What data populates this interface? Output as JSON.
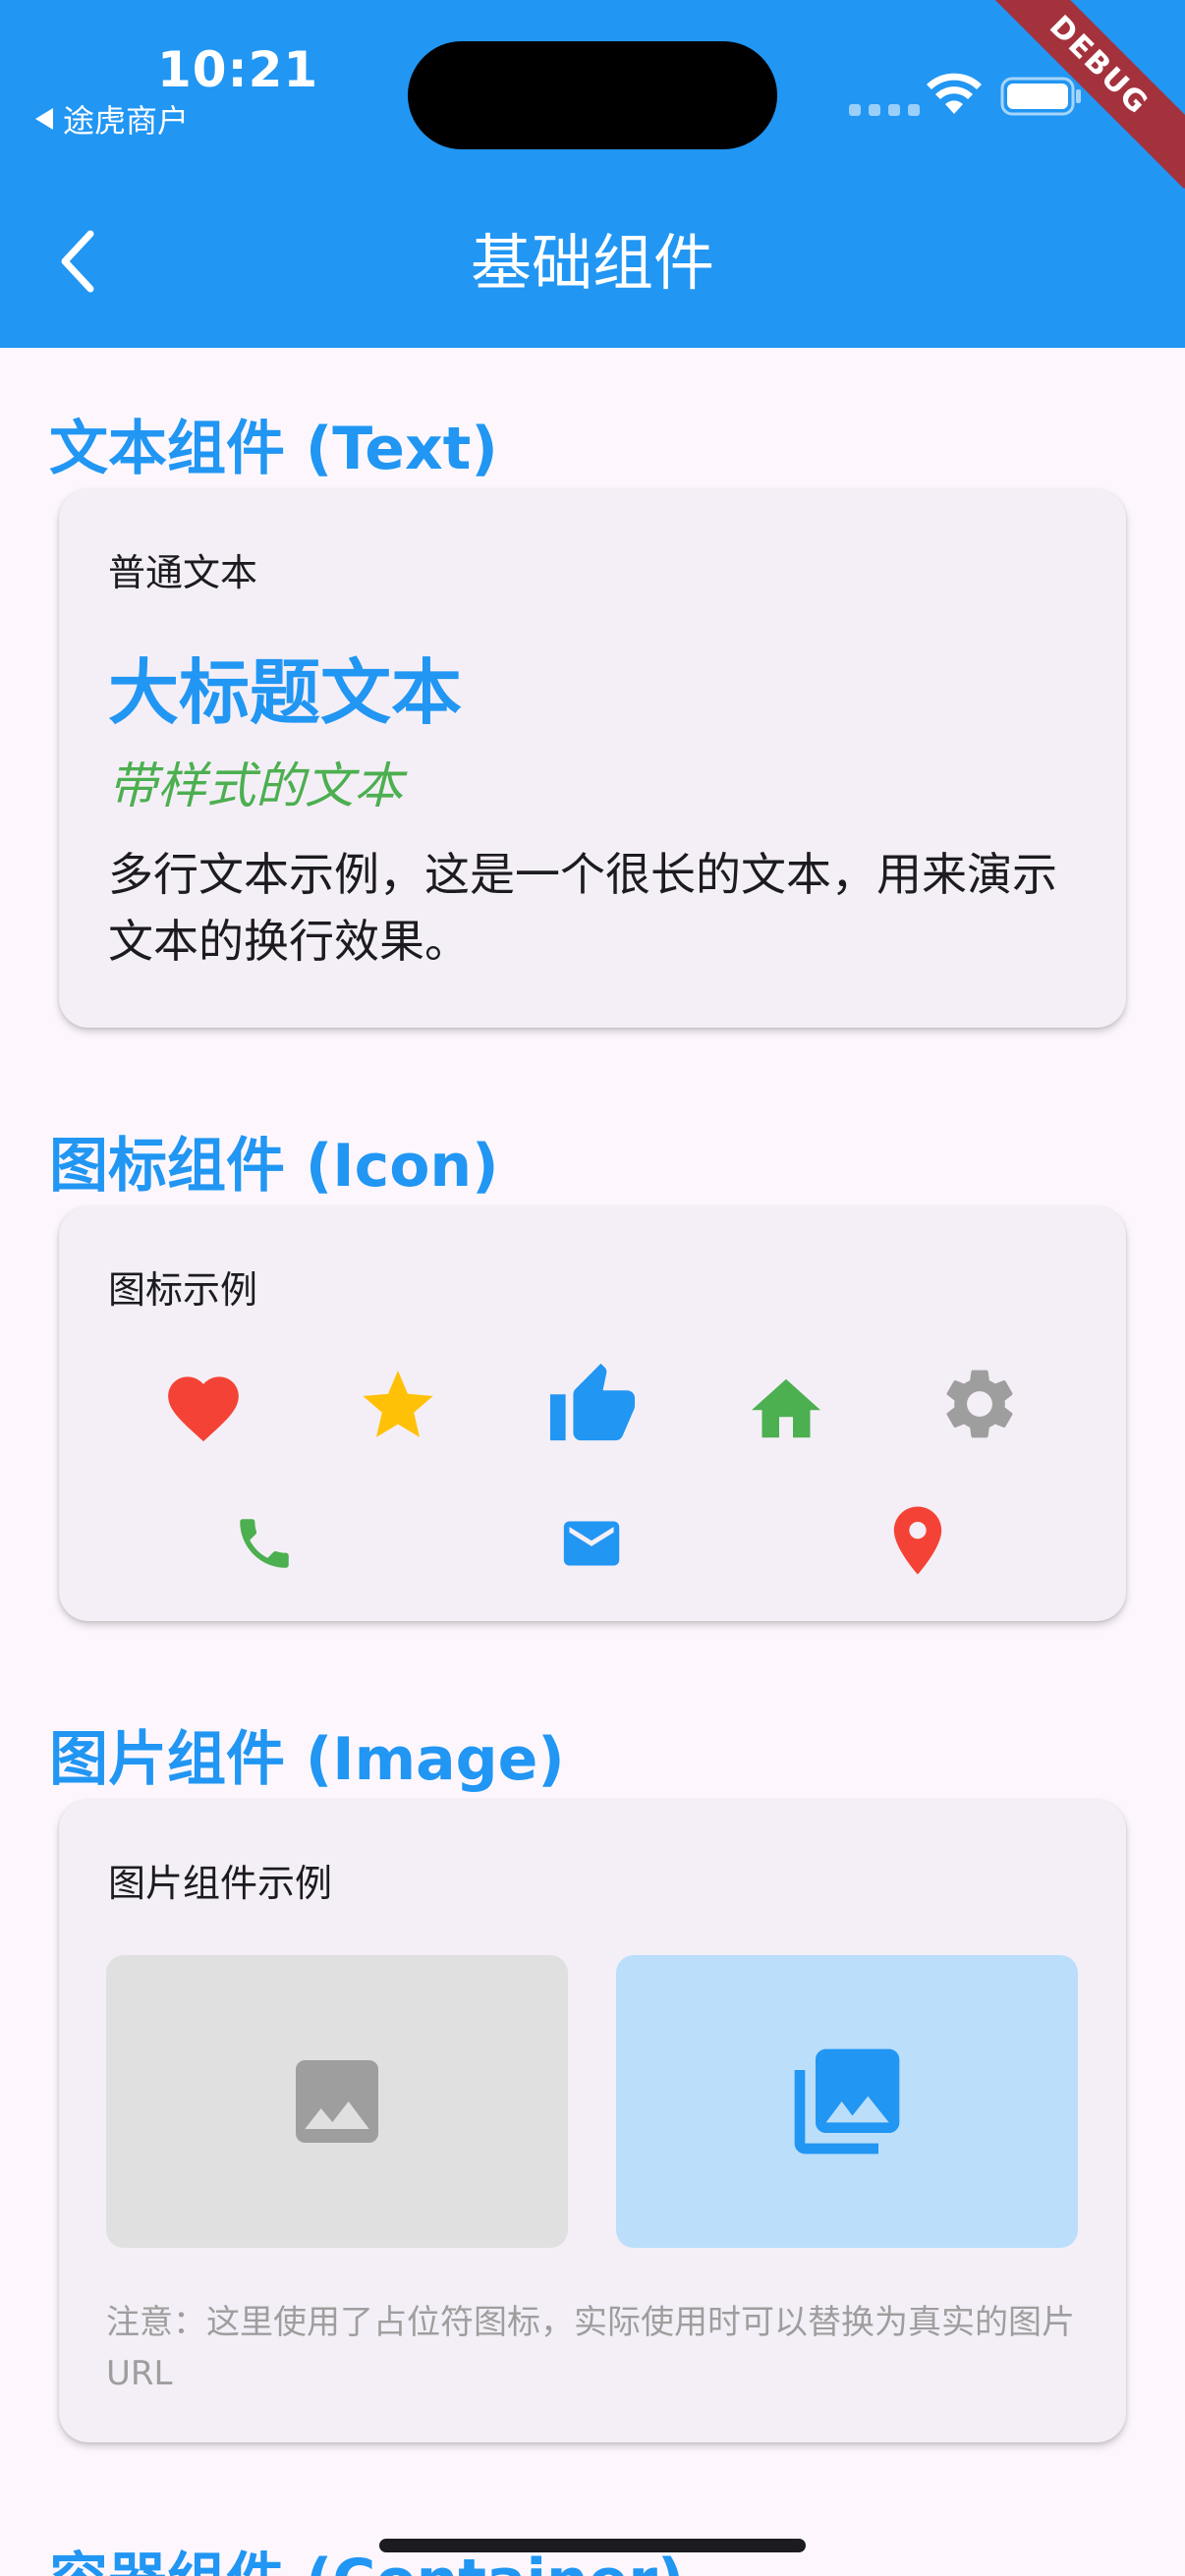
{
  "status_bar": {
    "time": "10:21",
    "back_app": "途虎商户",
    "debug_banner": "DEBUG"
  },
  "appbar": {
    "title": "基础组件"
  },
  "sections": {
    "text": {
      "title": "文本组件 (Text)",
      "normal": "普通文本",
      "big_title": "大标题文本",
      "styled": "带样式的文本",
      "multiline": "多行文本示例，这是一个很长的文本，用来演示文本的换行效果。"
    },
    "icon": {
      "title": "图标组件 (Icon)",
      "label": "图标示例",
      "icons": [
        {
          "name": "favorite-icon",
          "color": "#f44336"
        },
        {
          "name": "star-icon",
          "color": "#ffc107"
        },
        {
          "name": "thumb-up-icon",
          "color": "#2196f3"
        },
        {
          "name": "home-icon",
          "color": "#4caf50"
        },
        {
          "name": "settings-icon",
          "color": "#9e9e9e"
        },
        {
          "name": "phone-icon",
          "color": "#4caf50"
        },
        {
          "name": "email-icon",
          "color": "#2196f3"
        },
        {
          "name": "location-icon",
          "color": "#f44336"
        }
      ]
    },
    "image": {
      "title": "图片组件 (Image)",
      "label": "图片组件示例",
      "placeholders": [
        {
          "name": "image-placeholder-icon",
          "background": "#e0e0e0",
          "icon_color": "#9e9e9e"
        },
        {
          "name": "photo-library-icon",
          "background": "#bbdefb",
          "icon_color": "#2196f3"
        }
      ],
      "note": "注意：这里使用了占位符图标，实际使用时可以替换为真实的图片URL"
    },
    "container": {
      "title": "容器组件 (Container)"
    }
  },
  "colors": {
    "primary": "#2196f3",
    "background": "#fdf7fd",
    "card": "#f4eff6"
  }
}
